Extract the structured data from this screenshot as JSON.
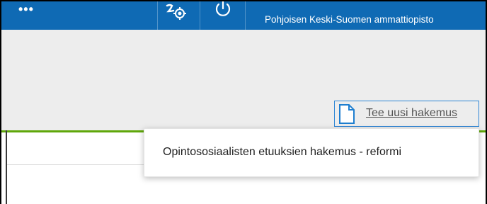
{
  "topbar": {
    "menu_label": "•••",
    "organization": "Pohjoisen Keski-Suomen ammattiopisto",
    "icons": [
      "more-icon",
      "user-settings-icon",
      "power-icon"
    ]
  },
  "toolbar": {
    "new_application_label": "Tee uusi hakemus"
  },
  "dropdown": {
    "items": [
      {
        "label": "Opintososiaalisten etuuksien hakemus - reformi"
      }
    ]
  },
  "colors": {
    "topbar": "#0f6ab4",
    "accent_green": "#5fa70a",
    "focus_border": "#2e86d6",
    "background": "#ededed"
  }
}
